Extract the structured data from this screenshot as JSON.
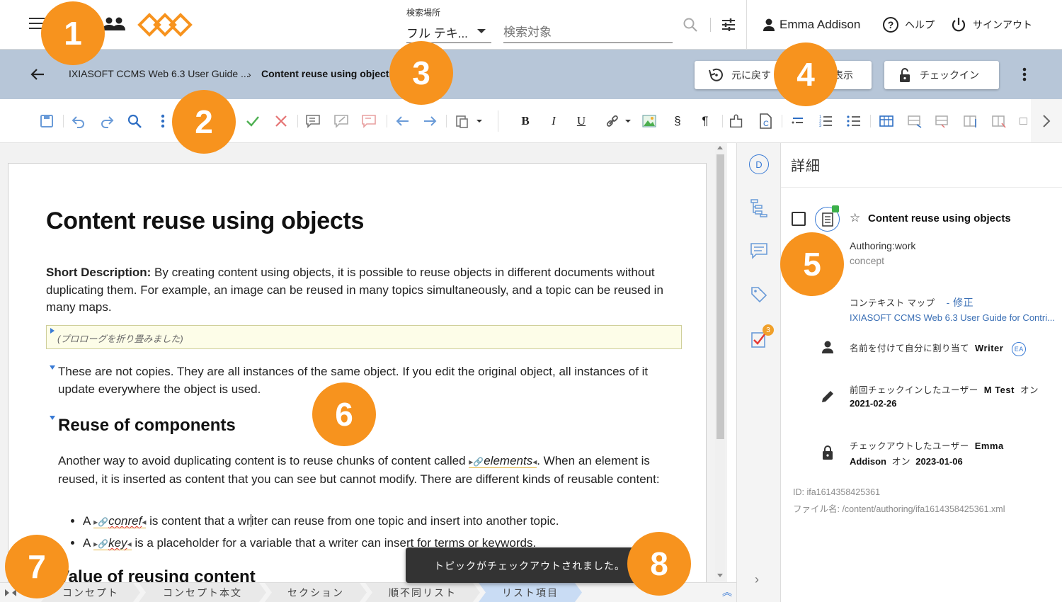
{
  "topbar": {
    "search_location_label": "検索場所",
    "search_location_value": "フル テキ...",
    "search_placeholder": "検索対象",
    "user_name": "Emma Addison",
    "help_label": "ヘルプ",
    "signout_label": "サインアウト"
  },
  "breadcrumb": {
    "parent": "IXIASOFT CCMS Web 6.3 User Guide ...",
    "current": "Content reuse using objects",
    "revert_label": "元に戻す",
    "view_label": "表示",
    "checkin_label": "チェックイン"
  },
  "toolbar": {
    "icons": [
      "save-icon",
      "undo-icon",
      "redo-icon",
      "find-icon",
      "more-icon",
      "accept-icon",
      "reject-icon",
      "add-comment-icon",
      "edit-comment-icon",
      "reply-comment-icon",
      "prev-icon",
      "next-icon",
      "paste-icon",
      "bold-icon",
      "italic-icon",
      "underline-icon",
      "link-icon",
      "image-icon",
      "section-icon",
      "pilcrow-icon",
      "component-icon",
      "conref-icon",
      "list-insert-icon",
      "ordered-list-icon",
      "unordered-list-icon",
      "table-icon",
      "table-row-icon",
      "table-row-after-icon",
      "table-col-icon",
      "table-col-delete-icon"
    ]
  },
  "document": {
    "title": "Content reuse using objects",
    "shortdesc_label": "Short Description:",
    "shortdesc_text": " By creating content using objects, it is possible to reuse objects in different documents without duplicating them. For example, an image can be reused in many topics simultaneously, and a topic can be reused in many maps.",
    "prolog": "(プロローグを折り畳みました)",
    "para1": "These are not copies. They are all instances of the same object. If you edit the original object, all instances of it update everywhere the object is used.",
    "heading1": "Reuse of components",
    "para2_before": "Another way to avoid duplicating content is to reuse chunks of content called ",
    "para2_ref": "elements",
    "para2_after": ". When an element is reused, it is inserted as content that you can see but cannot modify. There are different kinds of reusable content:",
    "bullet1_a": "A ",
    "bullet1_ref": "conref",
    "bullet1_b": " is content that a wr",
    "bullet1_c": "iter can reuse from one topic and insert into another topic.",
    "bullet2_a": "A ",
    "bullet2_ref": "key",
    "bullet2_b": " is a placeholder for a variable that a writer can insert for terms or keywords.",
    "heading2": "Value of reusing content"
  },
  "path": [
    "コンセプト",
    "コンセプト本文",
    "セクション",
    "順不同リスト",
    "リスト項目"
  ],
  "toast": "トピックがチェックアウトされました。",
  "rail": {
    "d_label": "D",
    "tasks_count": "3"
  },
  "details": {
    "heading": "詳細",
    "topic_title": "Content reuse using objects",
    "status": "Authoring:work",
    "type": "concept",
    "context_map_label": "コンテキスト マップ",
    "context_map_edit": "- 修正",
    "context_map_value": "IXIASOFT CCMS Web 6.3 User Guide for Contri...",
    "assign_label": "名前を付けて自分に割り当て",
    "assign_user": "Writer",
    "assign_badge": "EA",
    "last_checkin_label": "前回チェックインしたユーザー",
    "last_checkin_user": "M Test",
    "last_checkin_on": "オン",
    "last_checkin_date": "2021-02-26",
    "checkout_label": "チェックアウトしたユーザー",
    "checkout_user_a": "Emma",
    "checkout_user_b": "Addison",
    "checkout_on": "オン",
    "checkout_date": "2023-01-06",
    "id_line": "ID: ifa1614358425361",
    "file_line": "ファイル名: /content/authoring/ifa1614358425361.xml"
  },
  "callouts": [
    "1",
    "2",
    "3",
    "4",
    "5",
    "6",
    "7",
    "8"
  ],
  "colors": {
    "accent": "#3a7bd5",
    "callout": "#f7931e",
    "crumbbar": "#b7c6d8"
  }
}
